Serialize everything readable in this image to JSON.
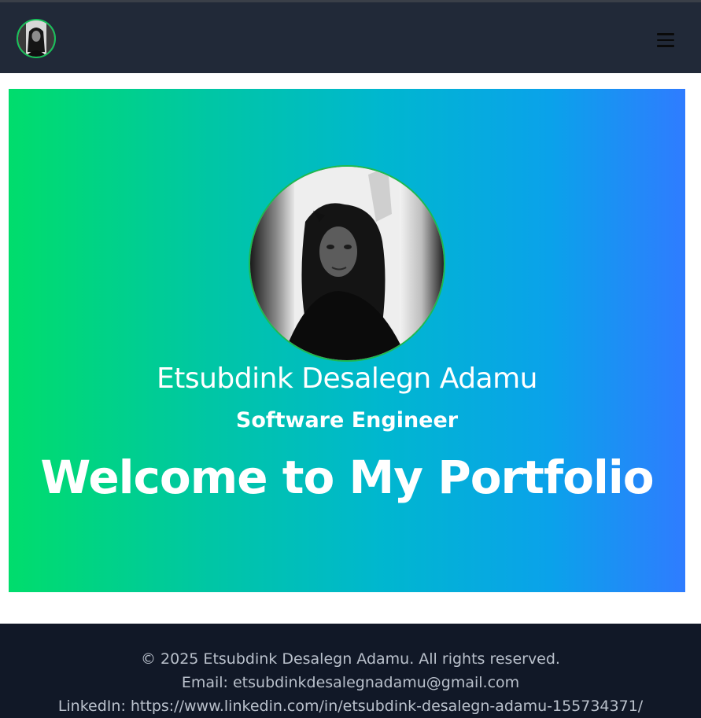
{
  "navbar": {
    "avatar_icon": "profile-photo",
    "menu_icon": "hamburger-menu-icon"
  },
  "hero": {
    "photo": "profile-photo",
    "name": "Etsubdink Desalegn Adamu",
    "role": "Software Engineer",
    "welcome": "Welcome to My Portfolio",
    "gradient_colors": [
      "#00dd6c",
      "#00b7cf",
      "#2f7cff"
    ]
  },
  "footer": {
    "copyright": "© 2025 Etsubdink Desalegn Adamu. All rights reserved.",
    "email": "Email: etsubdinkdesalegnadamu@gmail.com",
    "linkedin": "LinkedIn: https://www.linkedin.com/in/etsubdink-desalegn-adamu-155734371/"
  },
  "colors": {
    "navbar_bg": "#212938",
    "footer_bg": "#111827",
    "avatar_border": "#17c35a"
  }
}
